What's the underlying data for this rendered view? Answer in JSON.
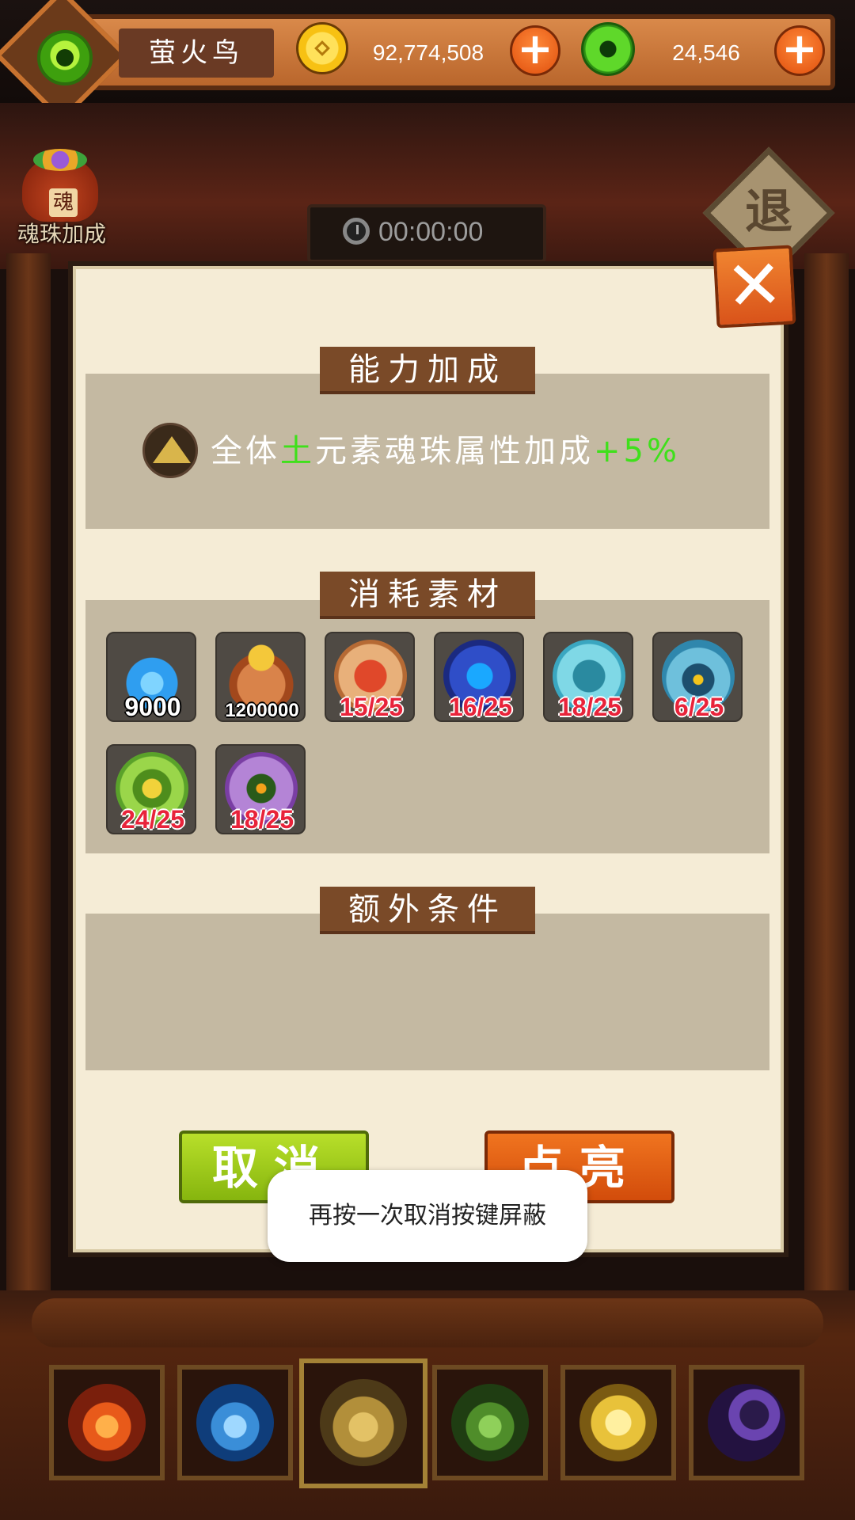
{
  "header": {
    "player_name": "萤火鸟",
    "gold_amount": "92,774,508",
    "jade_amount": "24,546",
    "gold_plus": "+",
    "jade_plus": "+"
  },
  "soul_bag": {
    "badge": "魂",
    "label": "魂珠加成"
  },
  "timer": {
    "value": "00:00:00"
  },
  "exit": {
    "label": "退",
    "close": "✕"
  },
  "sections": {
    "ability": "能力加成",
    "materials": "消耗素材",
    "extra": "额外条件"
  },
  "bonus": {
    "prefix": "全体",
    "element": "土",
    "middle": "元素魂珠属性加成",
    "value": "+5%"
  },
  "materials": [
    {
      "name": "blue-flame",
      "count": "9000",
      "color": "#2f9ef0"
    },
    {
      "name": "coin-bag",
      "count": "1200000",
      "color": "#c86a35"
    },
    {
      "name": "red-totem-orb",
      "count": "15/25",
      "color": "#d9884e"
    },
    {
      "name": "blue-crystal-orb",
      "count": "16/25",
      "color": "#4a6fd8"
    },
    {
      "name": "cyan-puzzle-orb",
      "count": "18/25",
      "color": "#5fc4d8"
    },
    {
      "name": "eye-pyramid-orb",
      "count": "6/25",
      "color": "#4aa0c8"
    },
    {
      "name": "green-clover-orb",
      "count": "24/25",
      "color": "#7ac43a"
    },
    {
      "name": "purple-feather-orb",
      "count": "18/25",
      "color": "#9a5ac0"
    }
  ],
  "buttons": {
    "cancel": "取消",
    "light_up": "点亮"
  },
  "toast": {
    "message": "再按一次取消按键屏蔽"
  },
  "elements_bar": [
    {
      "name": "fire",
      "color": "#d9461c"
    },
    {
      "name": "water",
      "color": "#3a8ed8"
    },
    {
      "name": "earth",
      "color": "#c9a44a",
      "selected": true
    },
    {
      "name": "wood",
      "color": "#5aa23a"
    },
    {
      "name": "light",
      "color": "#e8c23a"
    },
    {
      "name": "dark",
      "color": "#4a2a8a"
    }
  ]
}
